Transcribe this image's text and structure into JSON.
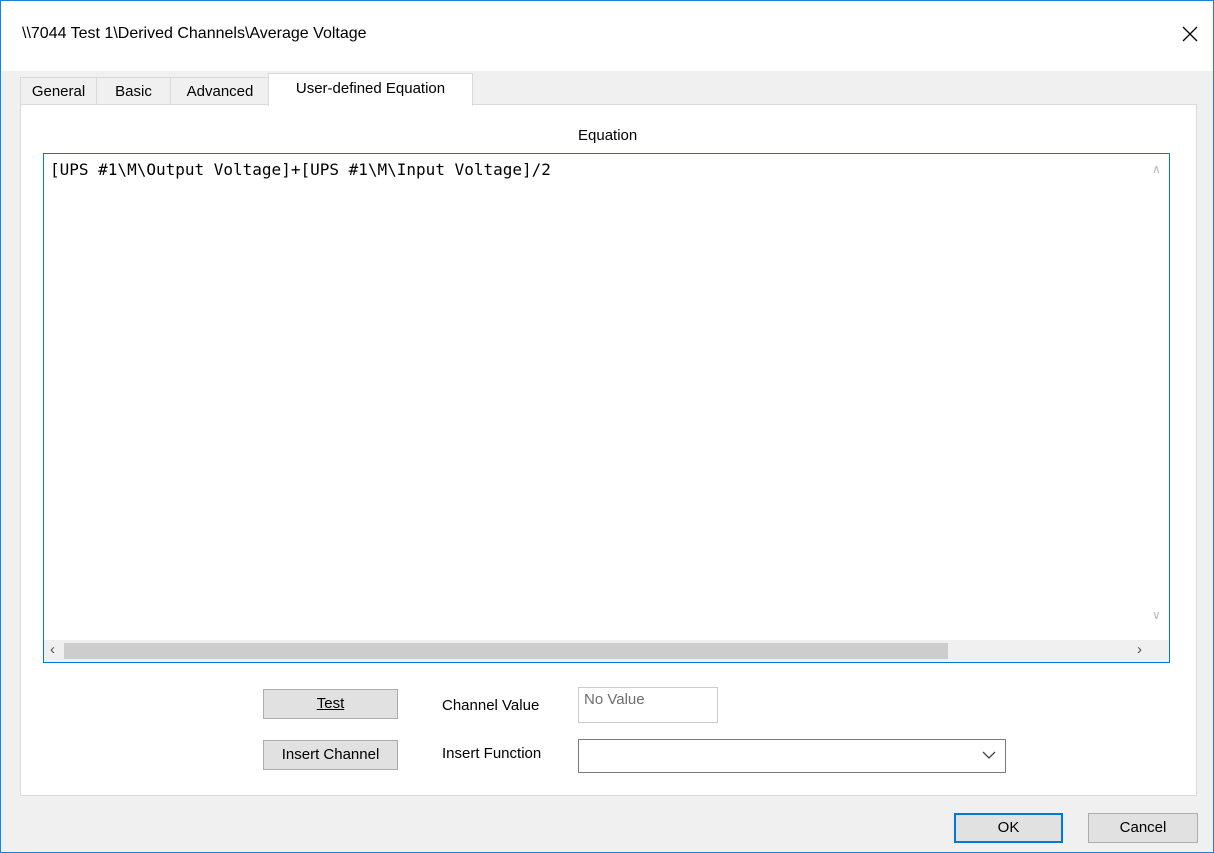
{
  "window": {
    "title": "\\\\7044 Test 1\\Derived Channels\\Average Voltage"
  },
  "tabs": [
    {
      "label": "General"
    },
    {
      "label": "Basic"
    },
    {
      "label": "Advanced"
    },
    {
      "label": "User-defined Equation",
      "active": true
    }
  ],
  "equation": {
    "label": "Equation",
    "value": "[UPS #1\\M\\Output Voltage]+[UPS #1\\M\\Input Voltage]/2"
  },
  "controls": {
    "test_button_label": "Test",
    "insert_channel_label": "Insert Channel",
    "channel_value_label": "Channel Value",
    "channel_value_text": "No Value",
    "insert_function_label": "Insert Function",
    "insert_function_value": ""
  },
  "footer": {
    "ok_label": "OK",
    "cancel_label": "Cancel"
  },
  "colors": {
    "accent": "#0078d7",
    "dialog_bg": "#f0f0f0",
    "button_bg": "#e1e1e1"
  },
  "icons": {
    "close": "close-icon",
    "dropdown": "chevron-down-icon",
    "scroll_left": "arrow-left-icon",
    "scroll_right": "arrow-right-icon",
    "scroll_up": "arrow-up-icon",
    "scroll_down": "arrow-down-icon"
  }
}
